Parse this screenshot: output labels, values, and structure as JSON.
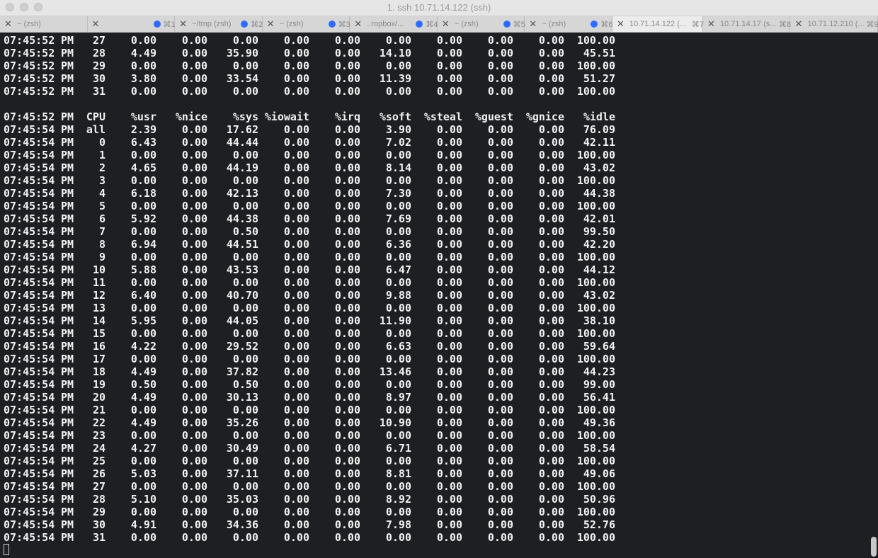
{
  "window": {
    "title": "1. ssh 10.71.14.122 (ssh)"
  },
  "tabs": [
    {
      "label": "~ (zsh)",
      "shortcut": "",
      "dot": false,
      "active": false
    },
    {
      "label": "",
      "shortcut": "⌘1",
      "dot": true,
      "active": false
    },
    {
      "label": "~/tmp (zsh)",
      "shortcut": "⌘2",
      "dot": true,
      "active": false
    },
    {
      "label": "~ (zsh)",
      "shortcut": "⌘3",
      "dot": true,
      "active": false
    },
    {
      "label": "..ropbox/...",
      "shortcut": "⌘4",
      "dot": true,
      "active": false
    },
    {
      "label": "~ (zsh)",
      "shortcut": "⌘5",
      "dot": true,
      "active": false
    },
    {
      "label": "~ (zsh)",
      "shortcut": "⌘6",
      "dot": true,
      "active": false
    },
    {
      "label": "10.71.14.122 (...",
      "shortcut": "⌘7",
      "dot": false,
      "active": true
    },
    {
      "label": "10.71.14.17 (s...",
      "shortcut": "⌘8",
      "dot": false,
      "active": false
    },
    {
      "label": "10.71.12.210 (...",
      "shortcut": "⌘9",
      "dot": false,
      "active": false
    }
  ],
  "terminal": {
    "lines": [
      [
        "07:45:52",
        "PM",
        "27",
        "0.00",
        "0.00",
        "0.00",
        "0.00",
        "0.00",
        "0.00",
        "0.00",
        "0.00",
        "0.00",
        "100.00"
      ],
      [
        "07:45:52",
        "PM",
        "28",
        "4.49",
        "0.00",
        "35.90",
        "0.00",
        "0.00",
        "14.10",
        "0.00",
        "0.00",
        "0.00",
        "45.51"
      ],
      [
        "07:45:52",
        "PM",
        "29",
        "0.00",
        "0.00",
        "0.00",
        "0.00",
        "0.00",
        "0.00",
        "0.00",
        "0.00",
        "0.00",
        "100.00"
      ],
      [
        "07:45:52",
        "PM",
        "30",
        "3.80",
        "0.00",
        "33.54",
        "0.00",
        "0.00",
        "11.39",
        "0.00",
        "0.00",
        "0.00",
        "51.27"
      ],
      [
        "07:45:52",
        "PM",
        "31",
        "0.00",
        "0.00",
        "0.00",
        "0.00",
        "0.00",
        "0.00",
        "0.00",
        "0.00",
        "0.00",
        "100.00"
      ],
      [],
      [
        "07:45:52",
        "PM",
        "CPU",
        "%usr",
        "%nice",
        "%sys",
        "%iowait",
        "%irq",
        "%soft",
        "%steal",
        "%guest",
        "%gnice",
        "%idle"
      ],
      [
        "07:45:54",
        "PM",
        "all",
        "2.39",
        "0.00",
        "17.62",
        "0.00",
        "0.00",
        "3.90",
        "0.00",
        "0.00",
        "0.00",
        "76.09"
      ],
      [
        "07:45:54",
        "PM",
        "0",
        "6.43",
        "0.00",
        "44.44",
        "0.00",
        "0.00",
        "7.02",
        "0.00",
        "0.00",
        "0.00",
        "42.11"
      ],
      [
        "07:45:54",
        "PM",
        "1",
        "0.00",
        "0.00",
        "0.00",
        "0.00",
        "0.00",
        "0.00",
        "0.00",
        "0.00",
        "0.00",
        "100.00"
      ],
      [
        "07:45:54",
        "PM",
        "2",
        "4.65",
        "0.00",
        "44.19",
        "0.00",
        "0.00",
        "8.14",
        "0.00",
        "0.00",
        "0.00",
        "43.02"
      ],
      [
        "07:45:54",
        "PM",
        "3",
        "0.00",
        "0.00",
        "0.00",
        "0.00",
        "0.00",
        "0.00",
        "0.00",
        "0.00",
        "0.00",
        "100.00"
      ],
      [
        "07:45:54",
        "PM",
        "4",
        "6.18",
        "0.00",
        "42.13",
        "0.00",
        "0.00",
        "7.30",
        "0.00",
        "0.00",
        "0.00",
        "44.38"
      ],
      [
        "07:45:54",
        "PM",
        "5",
        "0.00",
        "0.00",
        "0.00",
        "0.00",
        "0.00",
        "0.00",
        "0.00",
        "0.00",
        "0.00",
        "100.00"
      ],
      [
        "07:45:54",
        "PM",
        "6",
        "5.92",
        "0.00",
        "44.38",
        "0.00",
        "0.00",
        "7.69",
        "0.00",
        "0.00",
        "0.00",
        "42.01"
      ],
      [
        "07:45:54",
        "PM",
        "7",
        "0.00",
        "0.00",
        "0.50",
        "0.00",
        "0.00",
        "0.00",
        "0.00",
        "0.00",
        "0.00",
        "99.50"
      ],
      [
        "07:45:54",
        "PM",
        "8",
        "6.94",
        "0.00",
        "44.51",
        "0.00",
        "0.00",
        "6.36",
        "0.00",
        "0.00",
        "0.00",
        "42.20"
      ],
      [
        "07:45:54",
        "PM",
        "9",
        "0.00",
        "0.00",
        "0.00",
        "0.00",
        "0.00",
        "0.00",
        "0.00",
        "0.00",
        "0.00",
        "100.00"
      ],
      [
        "07:45:54",
        "PM",
        "10",
        "5.88",
        "0.00",
        "43.53",
        "0.00",
        "0.00",
        "6.47",
        "0.00",
        "0.00",
        "0.00",
        "44.12"
      ],
      [
        "07:45:54",
        "PM",
        "11",
        "0.00",
        "0.00",
        "0.00",
        "0.00",
        "0.00",
        "0.00",
        "0.00",
        "0.00",
        "0.00",
        "100.00"
      ],
      [
        "07:45:54",
        "PM",
        "12",
        "6.40",
        "0.00",
        "40.70",
        "0.00",
        "0.00",
        "9.88",
        "0.00",
        "0.00",
        "0.00",
        "43.02"
      ],
      [
        "07:45:54",
        "PM",
        "13",
        "0.00",
        "0.00",
        "0.00",
        "0.00",
        "0.00",
        "0.00",
        "0.00",
        "0.00",
        "0.00",
        "100.00"
      ],
      [
        "07:45:54",
        "PM",
        "14",
        "5.95",
        "0.00",
        "44.05",
        "0.00",
        "0.00",
        "11.90",
        "0.00",
        "0.00",
        "0.00",
        "38.10"
      ],
      [
        "07:45:54",
        "PM",
        "15",
        "0.00",
        "0.00",
        "0.00",
        "0.00",
        "0.00",
        "0.00",
        "0.00",
        "0.00",
        "0.00",
        "100.00"
      ],
      [
        "07:45:54",
        "PM",
        "16",
        "4.22",
        "0.00",
        "29.52",
        "0.00",
        "0.00",
        "6.63",
        "0.00",
        "0.00",
        "0.00",
        "59.64"
      ],
      [
        "07:45:54",
        "PM",
        "17",
        "0.00",
        "0.00",
        "0.00",
        "0.00",
        "0.00",
        "0.00",
        "0.00",
        "0.00",
        "0.00",
        "100.00"
      ],
      [
        "07:45:54",
        "PM",
        "18",
        "4.49",
        "0.00",
        "37.82",
        "0.00",
        "0.00",
        "13.46",
        "0.00",
        "0.00",
        "0.00",
        "44.23"
      ],
      [
        "07:45:54",
        "PM",
        "19",
        "0.50",
        "0.00",
        "0.50",
        "0.00",
        "0.00",
        "0.00",
        "0.00",
        "0.00",
        "0.00",
        "99.00"
      ],
      [
        "07:45:54",
        "PM",
        "20",
        "4.49",
        "0.00",
        "30.13",
        "0.00",
        "0.00",
        "8.97",
        "0.00",
        "0.00",
        "0.00",
        "56.41"
      ],
      [
        "07:45:54",
        "PM",
        "21",
        "0.00",
        "0.00",
        "0.00",
        "0.00",
        "0.00",
        "0.00",
        "0.00",
        "0.00",
        "0.00",
        "100.00"
      ],
      [
        "07:45:54",
        "PM",
        "22",
        "4.49",
        "0.00",
        "35.26",
        "0.00",
        "0.00",
        "10.90",
        "0.00",
        "0.00",
        "0.00",
        "49.36"
      ],
      [
        "07:45:54",
        "PM",
        "23",
        "0.00",
        "0.00",
        "0.00",
        "0.00",
        "0.00",
        "0.00",
        "0.00",
        "0.00",
        "0.00",
        "100.00"
      ],
      [
        "07:45:54",
        "PM",
        "24",
        "4.27",
        "0.00",
        "30.49",
        "0.00",
        "0.00",
        "6.71",
        "0.00",
        "0.00",
        "0.00",
        "58.54"
      ],
      [
        "07:45:54",
        "PM",
        "25",
        "0.00",
        "0.00",
        "0.00",
        "0.00",
        "0.00",
        "0.00",
        "0.00",
        "0.00",
        "0.00",
        "100.00"
      ],
      [
        "07:45:54",
        "PM",
        "26",
        "5.03",
        "0.00",
        "37.11",
        "0.00",
        "0.00",
        "8.81",
        "0.00",
        "0.00",
        "0.00",
        "49.06"
      ],
      [
        "07:45:54",
        "PM",
        "27",
        "0.00",
        "0.00",
        "0.00",
        "0.00",
        "0.00",
        "0.00",
        "0.00",
        "0.00",
        "0.00",
        "100.00"
      ],
      [
        "07:45:54",
        "PM",
        "28",
        "5.10",
        "0.00",
        "35.03",
        "0.00",
        "0.00",
        "8.92",
        "0.00",
        "0.00",
        "0.00",
        "50.96"
      ],
      [
        "07:45:54",
        "PM",
        "29",
        "0.00",
        "0.00",
        "0.00",
        "0.00",
        "0.00",
        "0.00",
        "0.00",
        "0.00",
        "0.00",
        "100.00"
      ],
      [
        "07:45:54",
        "PM",
        "30",
        "4.91",
        "0.00",
        "34.36",
        "0.00",
        "0.00",
        "7.98",
        "0.00",
        "0.00",
        "0.00",
        "52.76"
      ],
      [
        "07:45:54",
        "PM",
        "31",
        "0.00",
        "0.00",
        "0.00",
        "0.00",
        "0.00",
        "0.00",
        "0.00",
        "0.00",
        "0.00",
        "100.00"
      ]
    ]
  },
  "colors": {
    "terminal_bg": "#1d1f22",
    "terminal_fg": "#f2f2f2",
    "tab_dot": "#2f6bff"
  }
}
